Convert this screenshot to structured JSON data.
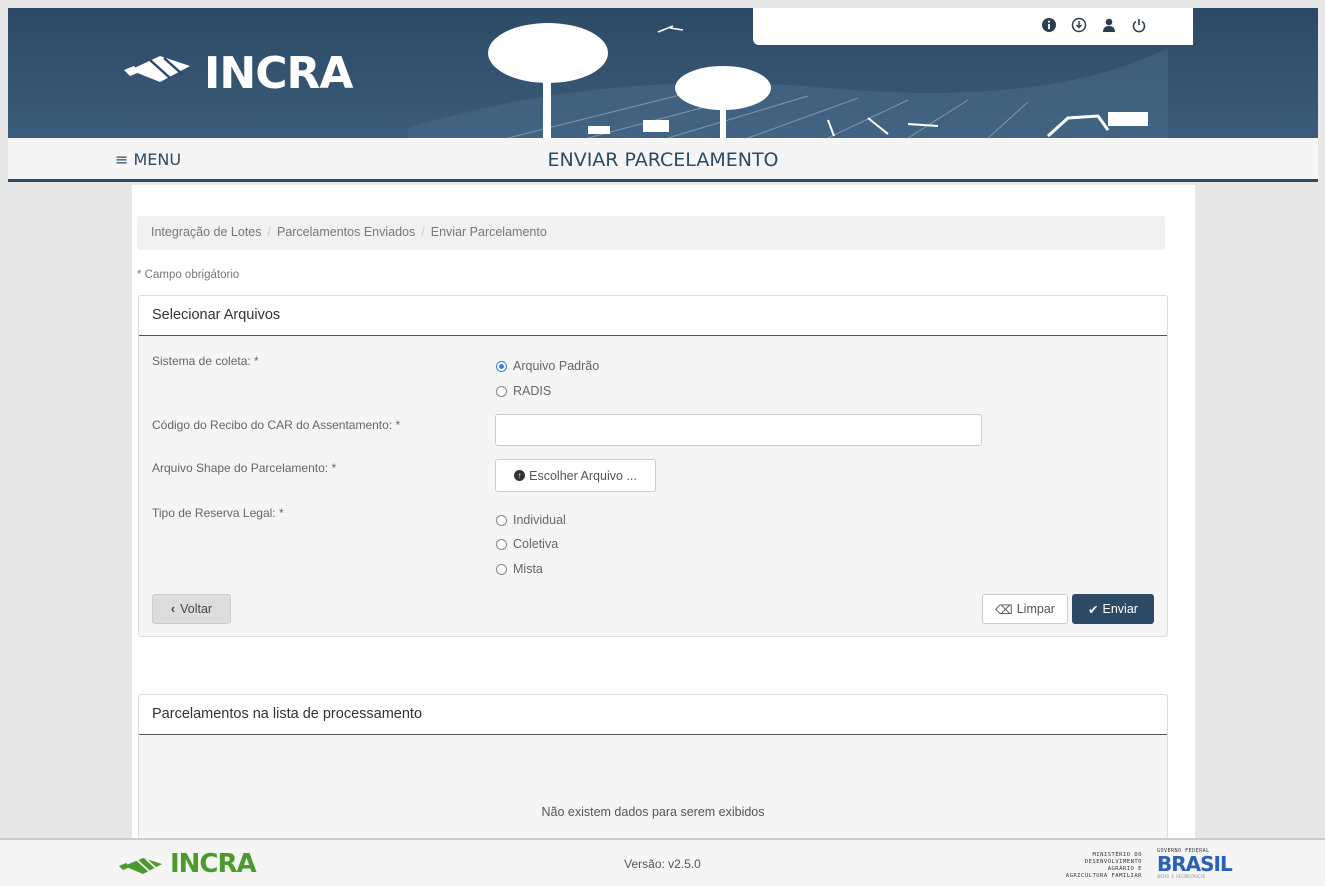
{
  "header": {
    "brand": "INCRA",
    "icons": [
      "info-icon",
      "download-icon",
      "user-icon",
      "power-icon"
    ]
  },
  "titlebar": {
    "menu_label": "≡ MENU",
    "title": "ENVIAR PARCELAMENTO"
  },
  "breadcrumb": {
    "items": [
      "Integração de Lotes",
      "Parcelamentos Enviados",
      "Enviar Parcelamento"
    ]
  },
  "form": {
    "required_note": "* Campo obrigátorio",
    "panel_title": "Selecionar Arquivos",
    "sistema_label": "Sistema de coleta: *",
    "sistema_options": [
      {
        "label": "Arquivo Padrão",
        "selected": true
      },
      {
        "label": "RADIS",
        "selected": false
      }
    ],
    "codigo_label": "Código do Recibo do CAR do Assentamento: *",
    "codigo_value": "",
    "shape_label": "Arquivo Shape do Parcelamento: *",
    "shape_button": "Escolher Arquivo ...",
    "reserva_label": "Tipo de Reserva Legal: *",
    "reserva_options": [
      {
        "label": "Individual",
        "selected": false
      },
      {
        "label": "Coletiva",
        "selected": false
      },
      {
        "label": "Mista",
        "selected": false
      }
    ],
    "back_button": "Voltar",
    "clear_button": "Limpar",
    "send_button": "Enviar"
  },
  "processing": {
    "panel_title": "Parcelamentos na lista de processamento",
    "empty_message": "Não existem dados para serem exibidos"
  },
  "footer": {
    "brand": "INCRA",
    "version": "Versão: v2.5.0",
    "ministry_lines": [
      "MINISTÉRIO DO",
      "DESENVOLVIMENTO",
      "AGRÁRIO E",
      "AGRICULTURA FAMILIAR"
    ],
    "gov_title": "GOVERNO FEDERAL",
    "gov_main": "BRASIL",
    "gov_sub": "UNIÃO E RECONSTRUÇÃO"
  },
  "colors": {
    "primary": "#2c4a66",
    "brand_green": "#4a9a2c",
    "radio_selected": "#3b82d6"
  }
}
